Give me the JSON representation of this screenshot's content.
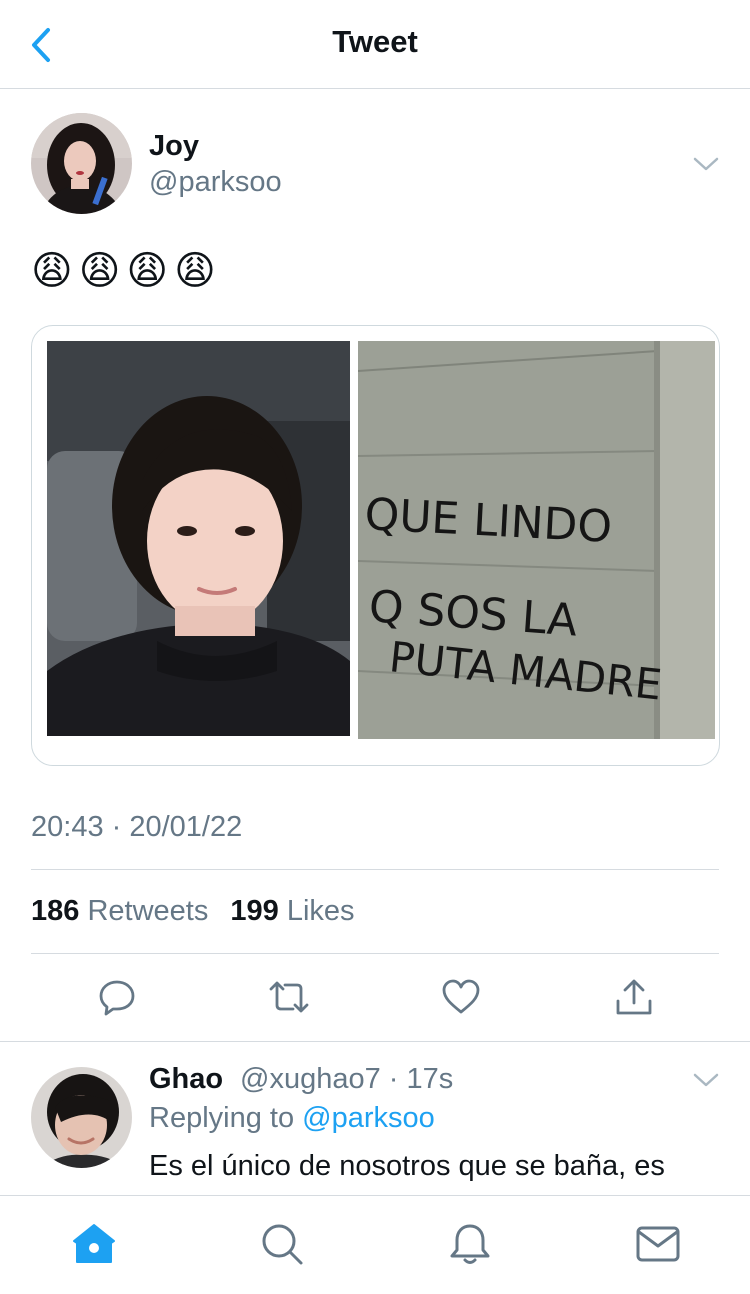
{
  "header": {
    "title": "Tweet",
    "back_icon": "chevron-left-icon"
  },
  "tweet": {
    "author_name": "Joy",
    "author_handle": "@parksoo",
    "text": "😩😩😩😩",
    "media": {
      "right_image_text": [
        "QUE LINDO",
        "Q SOS LA",
        "PUTA MADRE"
      ]
    },
    "timestamp": "20:43 · 20/01/22",
    "retweets_count": "186",
    "retweets_label": "Retweets",
    "likes_count": "199",
    "likes_label": "Likes",
    "actions": [
      "reply-icon",
      "retweet-icon",
      "like-icon",
      "share-icon"
    ]
  },
  "reply": {
    "author_name": "Ghao",
    "meta": "@xughao7 · 17s",
    "replying_prefix": "Replying to",
    "replying_handle": "@parksoo",
    "text": "Es el único de nosotros que se baña, es"
  },
  "nav": {
    "items": [
      "home-icon",
      "search-icon",
      "notifications-icon",
      "messages-icon"
    ]
  },
  "colors": {
    "accent": "#1da1f2",
    "secondary_text": "#657786",
    "divider": "#d6dbe0"
  }
}
